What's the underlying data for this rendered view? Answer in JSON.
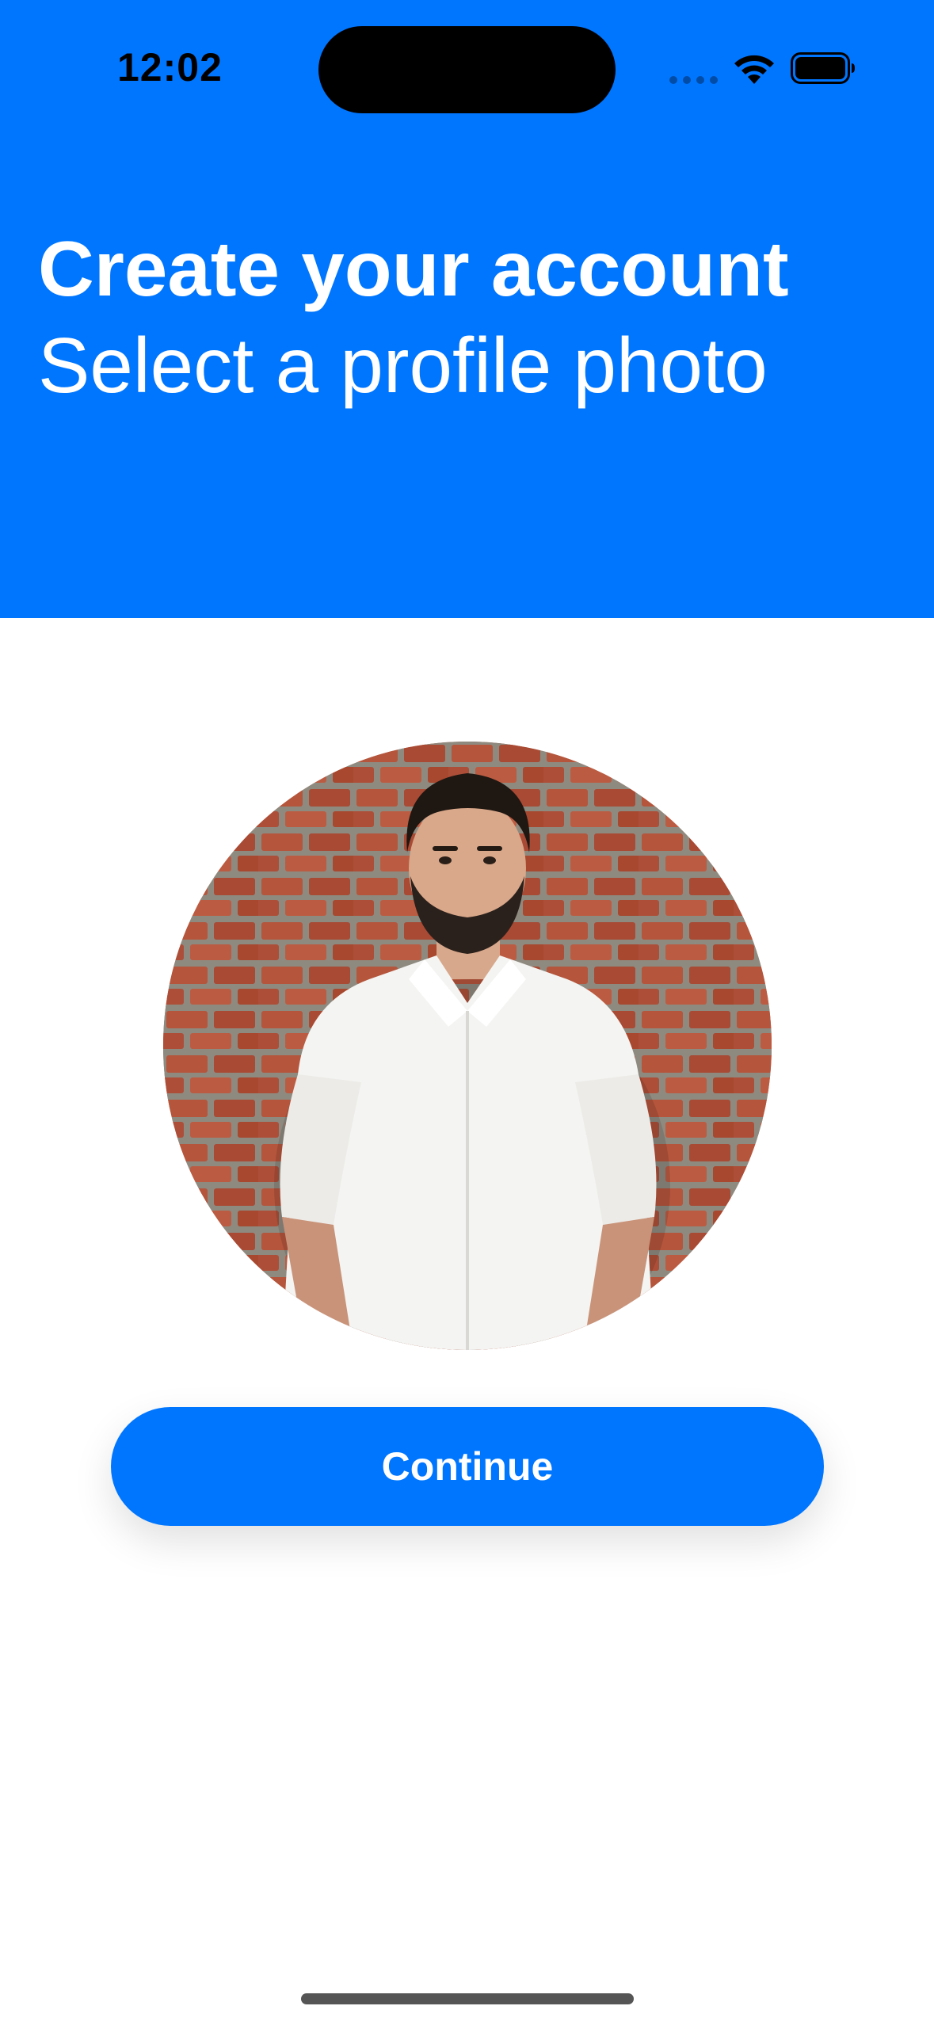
{
  "status_bar": {
    "time": "12:02",
    "icons": [
      "cellular-dots-icon",
      "wifi-icon",
      "battery-icon"
    ]
  },
  "header": {
    "title": "Create your account",
    "subtitle": "Select a profile photo",
    "background_color": "#0076FF"
  },
  "profile_photo": {
    "image": "profile-photo"
  },
  "actions": {
    "continue_label": "Continue",
    "button_color": "#0076FF"
  }
}
